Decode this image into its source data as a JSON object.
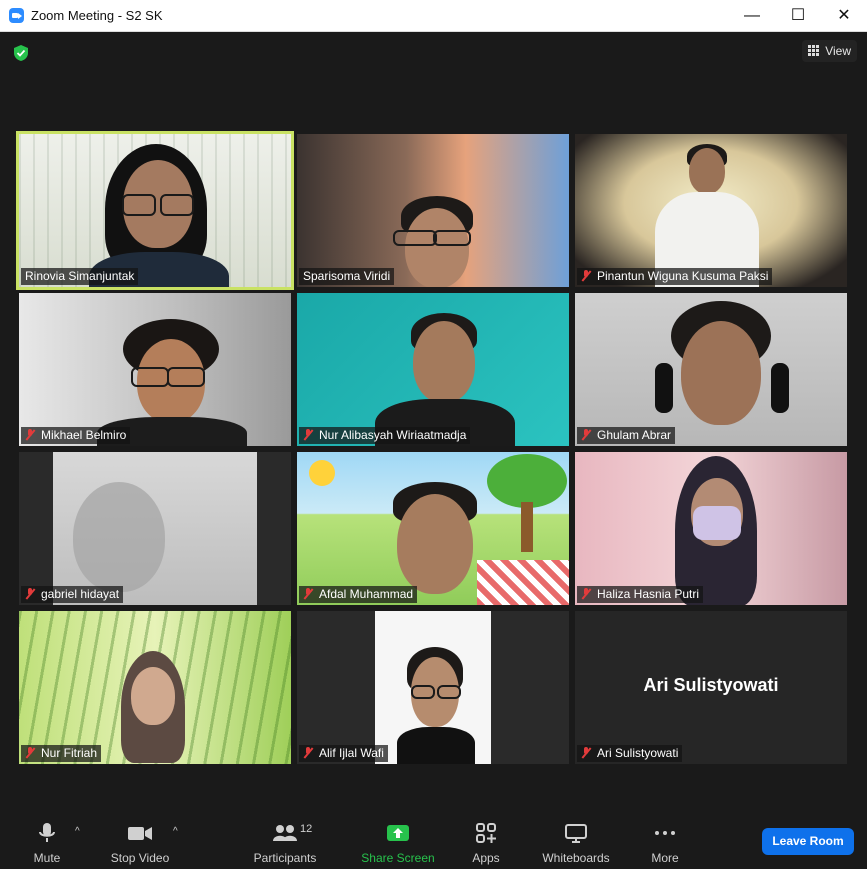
{
  "window": {
    "title": "Zoom Meeting - S2 SK",
    "minimize": "—",
    "maximize": "☐",
    "close": "✕"
  },
  "top": {
    "view_label": "View",
    "encryption_icon": "shield-check-icon"
  },
  "participants": [
    {
      "name": "Rinovia Simanjuntak",
      "muted": false,
      "active": true
    },
    {
      "name": "Sparisoma Viridi",
      "muted": false,
      "active": false
    },
    {
      "name": "Pinantun Wiguna Kusuma Paksi",
      "muted": true,
      "active": false
    },
    {
      "name": "Mikhael Belmiro",
      "muted": true,
      "active": false
    },
    {
      "name": "Nur Alibasyah Wiriaatmadja",
      "muted": true,
      "active": false
    },
    {
      "name": "Ghulam Abrar",
      "muted": true,
      "active": false
    },
    {
      "name": "gabriel hidayat",
      "muted": true,
      "active": false
    },
    {
      "name": "Afdal Muhammad",
      "muted": true,
      "active": false
    },
    {
      "name": "Haliza Hasnia Putri",
      "muted": true,
      "active": false
    },
    {
      "name": "Nur Fitriah",
      "muted": true,
      "active": false
    },
    {
      "name": "Alif Ijlal Wafi",
      "muted": true,
      "active": false
    },
    {
      "name": "Ari Sulistyowati",
      "muted": true,
      "active": false,
      "video_off": true
    }
  ],
  "toolbar": {
    "mute": "Mute",
    "stop_video": "Stop Video",
    "participants": "Participants",
    "participants_count": "12",
    "share_screen": "Share Screen",
    "apps": "Apps",
    "whiteboards": "Whiteboards",
    "more": "More",
    "leave": "Leave Room",
    "caret": "^"
  },
  "colors": {
    "share_green": "#27c24c",
    "leave_blue": "#0e71eb",
    "active_border": "#c9e264",
    "mute_red": "#e23b3b"
  }
}
